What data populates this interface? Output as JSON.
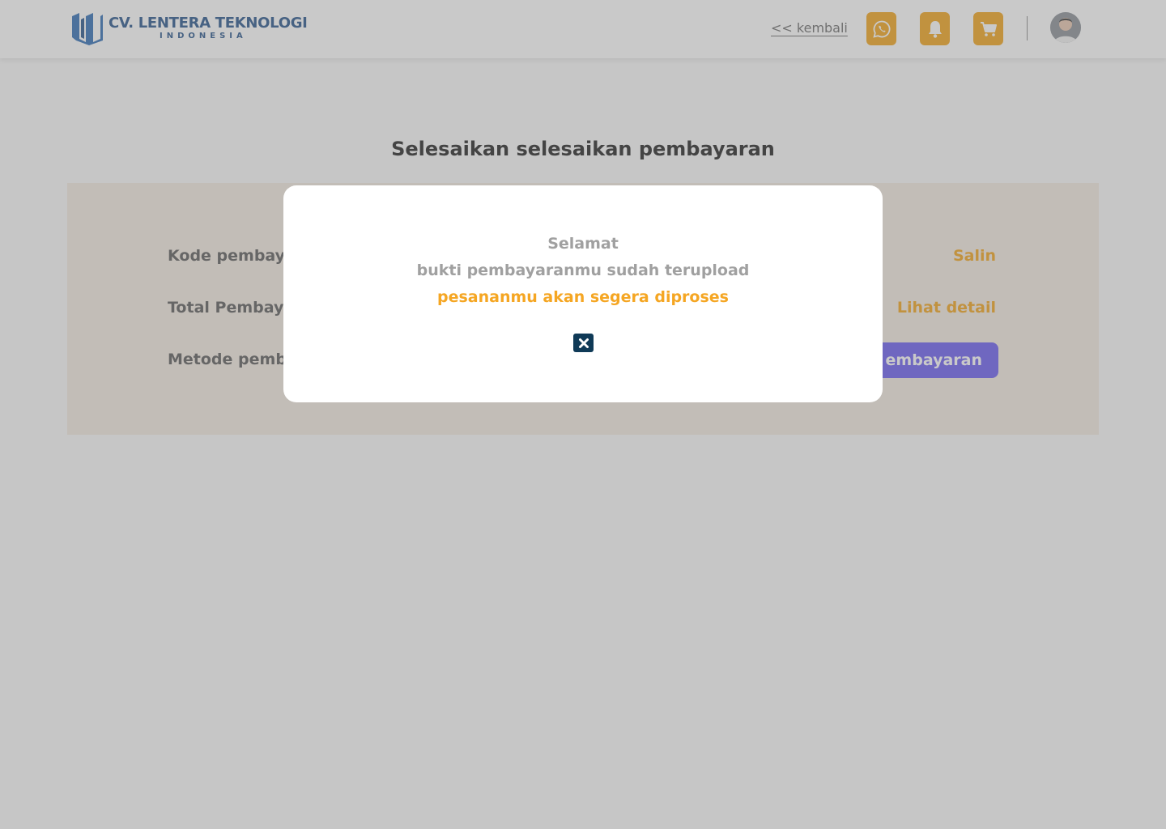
{
  "header": {
    "logo": {
      "name": "CV. LENTERA TEKNOLOGI",
      "subtitle": "INDONESIA"
    },
    "back_link": "<< kembali",
    "icons": [
      "whatsapp-icon",
      "bell-icon",
      "cart-icon"
    ],
    "accent_color": "#f2a31a"
  },
  "main": {
    "title": "Selesaikan selesaikan pembayaran",
    "rows": [
      {
        "label": "Kode pembay",
        "action": "Salin"
      },
      {
        "label": "Total Pembay",
        "action": "Lihat detail"
      },
      {
        "label": "Metode pemb",
        "action": "embayaran"
      }
    ],
    "button_color": "#6a5cf0"
  },
  "modal": {
    "line1": "Selamat",
    "line2": "bukti pembayaranmu sudah  terupload",
    "line3": "pesananmu akan segera diproses",
    "close_icon": "close-icon",
    "close_color": "#0f3a57"
  }
}
